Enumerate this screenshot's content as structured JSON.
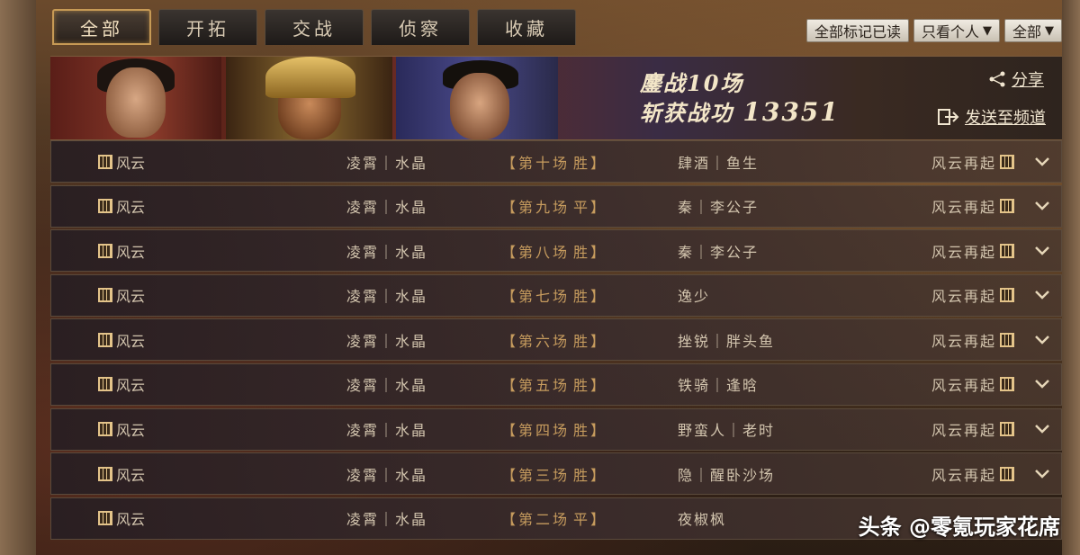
{
  "tabs": [
    {
      "label": "全部",
      "active": true
    },
    {
      "label": "开拓",
      "active": false
    },
    {
      "label": "交战",
      "active": false
    },
    {
      "label": "侦察",
      "active": false
    },
    {
      "label": "收藏",
      "active": false
    }
  ],
  "filters": {
    "mark_all_read": "全部标记已读",
    "personal_only": "只看个人",
    "scope": "全部"
  },
  "banner": {
    "battles_text": "鏖战10场",
    "merit_label": "斩获战功",
    "merit_value": "13351",
    "share_label": "分享",
    "send_label": "发送至频道"
  },
  "rows": [
    {
      "guild": "风云",
      "players": "凌霄｜水晶",
      "round": "【第十场",
      "result": "胜】",
      "opponent": "肆酒｜鱼生",
      "guild2": "风云再起"
    },
    {
      "guild": "风云",
      "players": "凌霄｜水晶",
      "round": "【第九场",
      "result": "平】",
      "opponent": "秦｜李公子",
      "guild2": "风云再起"
    },
    {
      "guild": "风云",
      "players": "凌霄｜水晶",
      "round": "【第八场",
      "result": "胜】",
      "opponent": "秦｜李公子",
      "guild2": "风云再起"
    },
    {
      "guild": "风云",
      "players": "凌霄｜水晶",
      "round": "【第七场",
      "result": "胜】",
      "opponent": "逸少",
      "guild2": "风云再起"
    },
    {
      "guild": "风云",
      "players": "凌霄｜水晶",
      "round": "【第六场",
      "result": "胜】",
      "opponent": "挫锐｜胖头鱼",
      "guild2": "风云再起"
    },
    {
      "guild": "风云",
      "players": "凌霄｜水晶",
      "round": "【第五场",
      "result": "胜】",
      "opponent": "铁骑｜逢晗",
      "guild2": "风云再起"
    },
    {
      "guild": "风云",
      "players": "凌霄｜水晶",
      "round": "【第四场",
      "result": "胜】",
      "opponent": "野蛮人｜老时",
      "guild2": "风云再起"
    },
    {
      "guild": "风云",
      "players": "凌霄｜水晶",
      "round": "【第三场",
      "result": "胜】",
      "opponent": "隐｜醒卧沙场",
      "guild2": "风云再起"
    },
    {
      "guild": "风云",
      "players": "凌霄｜水晶",
      "round": "【第二场",
      "result": "平】",
      "opponent": "夜椒枫",
      "guild2": ""
    }
  ],
  "watermark": "头条 @零氪玩家花席",
  "colors": {
    "accent": "#c79a55",
    "row_text": "#d3c5ae",
    "round_text": "#c79c5e"
  }
}
